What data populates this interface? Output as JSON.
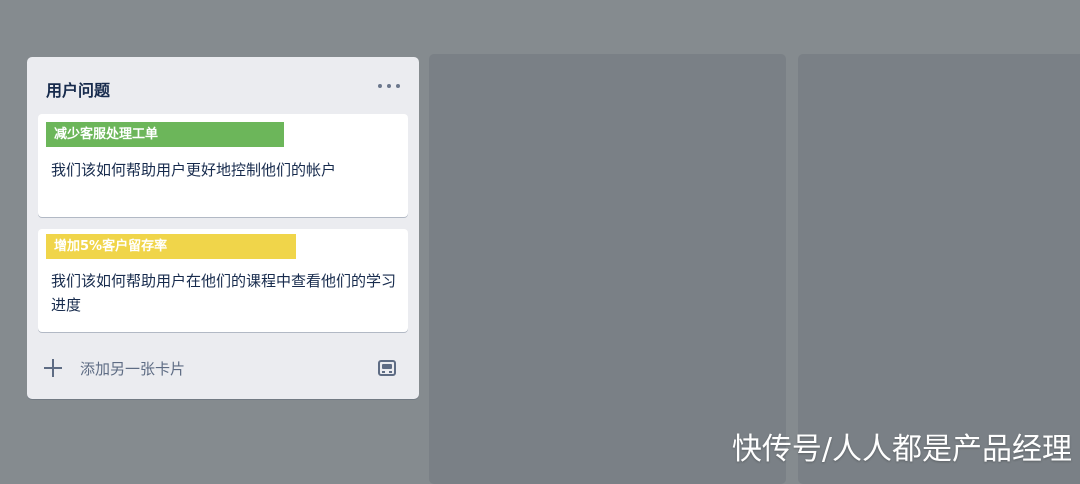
{
  "list": {
    "title": "用户问题",
    "menu_icon": "more-horizontal-icon",
    "cards": [
      {
        "label": "减少客服处理工单",
        "label_color": "#6cb65a",
        "title": "我们该如何帮助用户更好地控制他们的帐户"
      },
      {
        "label": "增加5%客户留存率",
        "label_color": "#f0d54a",
        "title": "我们该如何帮助用户在他们的课程中查看他们的学习进度"
      }
    ],
    "add_card_label": "添加另一张卡片",
    "add_icon": "plus-icon",
    "template_icon": "card-template-icon"
  },
  "watermark": "快传号/人人都是产品经理",
  "colors": {
    "background": "#858b8f",
    "column_placeholder": "#7a8086",
    "list_background": "#ebecf0"
  }
}
